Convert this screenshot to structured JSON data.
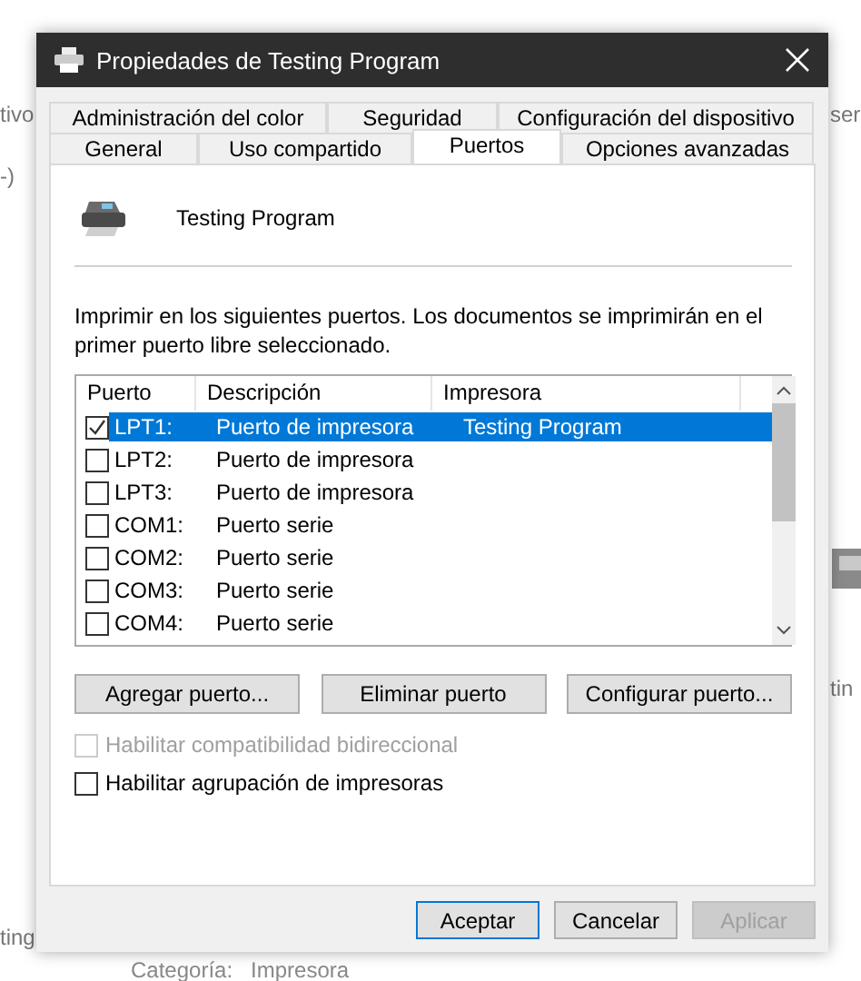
{
  "background": {
    "texts": [
      "tivo",
      "-)",
      "ser",
      "tin",
      "ting"
    ],
    "footer": {
      "label": "Categoría:",
      "value": "Impresora"
    }
  },
  "window": {
    "title": "Propiedades de Testing Program"
  },
  "tab_rows": [
    [
      {
        "label": "Administración del color",
        "selected": false
      },
      {
        "label": "Seguridad",
        "selected": false
      },
      {
        "label": "Configuración del dispositivo",
        "selected": false
      }
    ],
    [
      {
        "label": "General",
        "selected": false
      },
      {
        "label": "Uso compartido",
        "selected": false
      },
      {
        "label": "Puertos",
        "selected": true
      },
      {
        "label": "Opciones avanzadas",
        "selected": false
      }
    ]
  ],
  "printer": {
    "name": "Testing Program"
  },
  "instructions": "Imprimir en los siguientes puertos. Los documentos se imprimirán en el primer puerto libre seleccionado.",
  "ports": {
    "columns": [
      "Puerto",
      "Descripción",
      "Impresora"
    ],
    "rows": [
      {
        "port": "LPT1:",
        "description": "Puerto de impresora",
        "printer": "Testing Program",
        "checked": true,
        "selected": true
      },
      {
        "port": "LPT2:",
        "description": "Puerto de impresora",
        "checked": false,
        "selected": false
      },
      {
        "port": "LPT3:",
        "description": "Puerto de impresora",
        "checked": false,
        "selected": false
      },
      {
        "port": "COM1:",
        "description": "Puerto serie",
        "checked": false,
        "selected": false
      },
      {
        "port": "COM2:",
        "description": "Puerto serie",
        "checked": false,
        "selected": false
      },
      {
        "port": "COM3:",
        "description": "Puerto serie",
        "checked": false,
        "selected": false
      },
      {
        "port": "COM4:",
        "description": "Puerto serie",
        "checked": false,
        "selected": false
      }
    ]
  },
  "port_buttons": [
    "Agregar puerto...",
    "Eliminar puerto",
    "Configurar puerto..."
  ],
  "options": [
    {
      "label": "Habilitar compatibilidad bidireccional",
      "checked": false,
      "disabled": true
    },
    {
      "label": "Habilitar agrupación de impresoras",
      "checked": false,
      "disabled": false
    }
  ],
  "buttons": [
    {
      "label": "Aceptar",
      "default": true,
      "disabled": false
    },
    {
      "label": "Cancelar",
      "default": false,
      "disabled": false
    },
    {
      "label": "Aplicar",
      "default": false,
      "disabled": true
    }
  ]
}
